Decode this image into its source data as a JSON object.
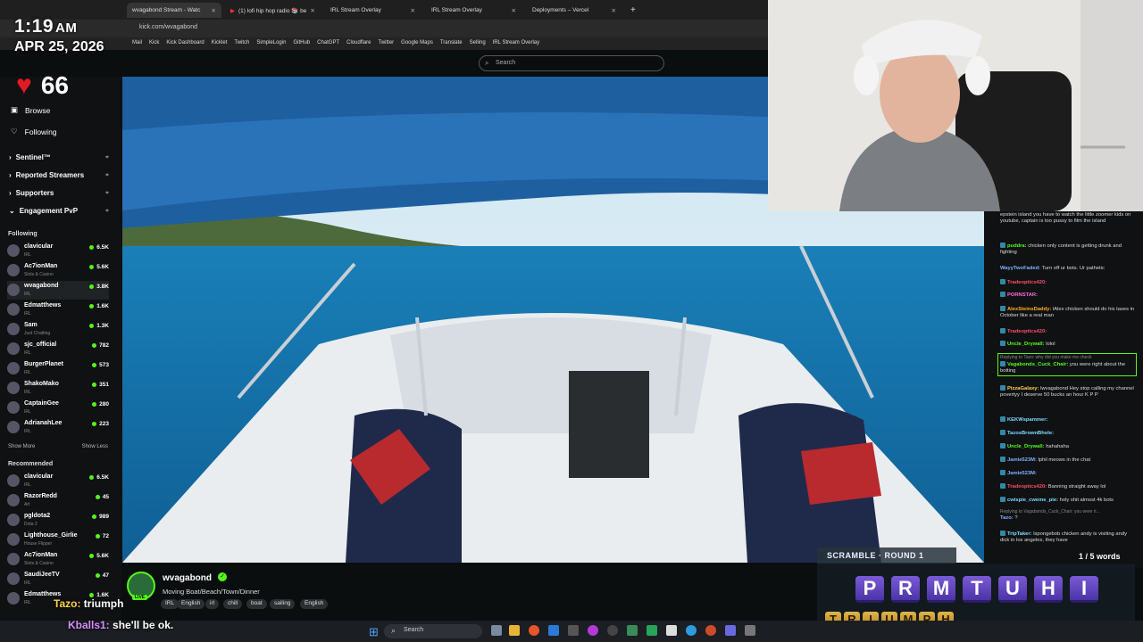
{
  "overlay": {
    "time": "1:19",
    "ampm": "AM",
    "date": "APR 25, 2026",
    "hearts": "66"
  },
  "browser": {
    "tabs": [
      {
        "label": "wvagabond Stream - Watc",
        "active": true
      },
      {
        "label": "(1) lofi hip hop radio 📚 be",
        "active": false
      },
      {
        "label": "IRL Stream Overlay",
        "active": false
      },
      {
        "label": "IRL Stream Overlay",
        "active": false
      },
      {
        "label": "Deployments – Vercel",
        "active": false
      }
    ],
    "url": "kick.com/wvagabond",
    "bookmarks": [
      "Mail",
      "Kick",
      "Kick Dashboard",
      "Kicklet",
      "Twitch",
      "SimpleLogin",
      "GitHub",
      "ChatGPT",
      "Cloudflare",
      "Twitter",
      "Google Maps",
      "Translate",
      "Selling",
      "IRL Stream Overlay"
    ]
  },
  "search": {
    "placeholder": "Search"
  },
  "sidebar": {
    "nav": [
      "Browse",
      "Following"
    ],
    "sections": [
      "Sentinel™",
      "Reported Streamers",
      "Supporters",
      "Engagement PvP"
    ],
    "following_label": "Following",
    "following": [
      {
        "name": "clavicular",
        "cat": "IRL",
        "viewers": "6.5K"
      },
      {
        "name": "Ac7ionMan",
        "cat": "Slots & Casino",
        "viewers": "5.6K"
      },
      {
        "name": "wvagabond",
        "cat": "IRL",
        "viewers": "3.8K"
      },
      {
        "name": "Edmatthews",
        "cat": "IRL",
        "viewers": "1.6K"
      },
      {
        "name": "Sam",
        "cat": "Just Chatting",
        "viewers": "1.3K"
      },
      {
        "name": "sjc_official",
        "cat": "IRL",
        "viewers": "782"
      },
      {
        "name": "BurgerPlanet",
        "cat": "IRL",
        "viewers": "573"
      },
      {
        "name": "ShakoMako",
        "cat": "IRL",
        "viewers": "351"
      },
      {
        "name": "CaptainGee",
        "cat": "IRL",
        "viewers": "280"
      },
      {
        "name": "AdrianahLee",
        "cat": "IRL",
        "viewers": "223"
      }
    ],
    "show_more": "Show More",
    "show_less": "Show Less",
    "recommended_label": "Recommended",
    "recommended": [
      {
        "name": "clavicular",
        "cat": "IRL",
        "viewers": "6.5K"
      },
      {
        "name": "RazorRedd",
        "cat": "Art",
        "viewers": "45"
      },
      {
        "name": "pgldota2",
        "cat": "Dota 2",
        "viewers": "989"
      },
      {
        "name": "Lighthouse_Girlie",
        "cat": "House Flipper",
        "viewers": "72"
      },
      {
        "name": "Ac7ionMan",
        "cat": "Slots & Casino",
        "viewers": "5.6K"
      },
      {
        "name": "SaudiJeeTV",
        "cat": "IRL",
        "viewers": "47"
      },
      {
        "name": "Edmatthews",
        "cat": "IRL",
        "viewers": "1.6K"
      }
    ]
  },
  "stream": {
    "channel": "wvagabond",
    "title": "Moving Boat/Beach/Town/Dinner",
    "tags": [
      "IRL",
      "English",
      "irl",
      "chill",
      "boat",
      "sailing",
      "English"
    ],
    "live": "LIVE"
  },
  "chat": [
    {
      "user": "",
      "text": "epstein island you have to watch the little zoomer kids on youtube, captain is too pussy to film the island",
      "color": "#dddddd"
    },
    {
      "user": "puddra:",
      "text": "chicken only content is getting drunk and fighting",
      "color": "#53fc18"
    },
    {
      "user": "WayyTwoFaded:",
      "text": "Turn off ur bots. Ur pathetic",
      "color": "#7fb4ff"
    },
    {
      "user": "Tradeoptics420:",
      "text": "",
      "color": "#ff4d6d"
    },
    {
      "user": "PORNSTAR:",
      "text": "",
      "color": "#ff6bd5"
    },
    {
      "user": "AlexSteinsDaddy:",
      "text": "lAlex chicken should do his taxes in October like a real man",
      "color": "#ffb020"
    },
    {
      "user": "Tradeoptics420:",
      "text": "",
      "color": "#ff4d6d"
    },
    {
      "user": "Uncle_Drywall:",
      "text": "lolol",
      "color": "#53fc18"
    },
    {
      "user": "Vagabonds_Cuck_Chair:",
      "text": "you were right about the botting",
      "color": "#53fc18",
      "reply": "Replying to Tazo: why did you make me check"
    },
    {
      "user": "PizzaGalaxy:",
      "text": "lwvagabond Hey stop calling my channel povertyy I deserve 50 bucks an hour K P P",
      "color": "#ffd24a"
    },
    {
      "user": "KEKWspammer:",
      "text": "",
      "color": "#7fdcff"
    },
    {
      "user": "TazosBrownBhole:",
      "text": "",
      "color": "#7fdcff"
    },
    {
      "user": "Uncle_Drywall:",
      "text": "hahahaha",
      "color": "#53fc18"
    },
    {
      "user": "Jamie523M:",
      "text": "lphil meows in the chat",
      "color": "#7fb4ff"
    },
    {
      "user": "Jamie523M:",
      "text": "",
      "color": "#7fb4ff"
    },
    {
      "user": "Tradeoptics420:",
      "text": "Banning straight away lol",
      "color": "#ff4d6d"
    },
    {
      "user": "cwispie_cweme_pie:",
      "text": "holy shit almost 4k bots",
      "color": "#7fdcff"
    },
    {
      "user": "Tazo:",
      "text": "?",
      "color": "#7fb4ff",
      "reply": "Replying to Vagabonds_Cuck_Chair: you were ri..."
    },
    {
      "user": "TripTaker:",
      "text": "lspongebob chicken andy is visiting andy dick in los angeles, they have",
      "color": "#7fdcff"
    }
  ],
  "scramble": {
    "title": "SCRAMBLE · ROUND 1",
    "progress": "1 / 5 words",
    "word_letters": [
      "P",
      "R",
      "M",
      "T",
      "U",
      "H",
      "I"
    ],
    "answer_letters": [
      "T",
      "R",
      "I",
      "U",
      "M",
      "P",
      "H"
    ]
  },
  "overlay_chat": [
    {
      "user": "Tazo:",
      "text": "triumph",
      "color": "#ffd24a"
    },
    {
      "user": "Kballs1:",
      "text": "she'll be ok.",
      "color": "#d98cff"
    }
  ],
  "taskbar": {
    "search": "Search"
  }
}
